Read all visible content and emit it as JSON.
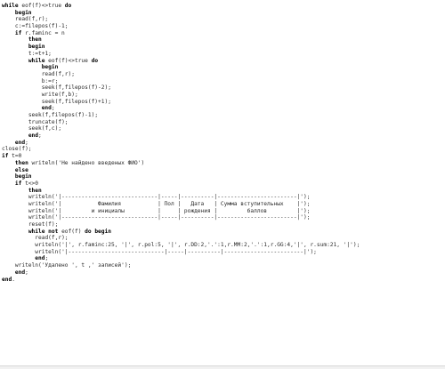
{
  "editor": {
    "lines": [
      {
        "pre": "",
        "kw": "while",
        "rest": " eof(f)<>true ",
        "kw2": "do",
        "rest2": ""
      },
      {
        "pre": "    ",
        "kw": "begin",
        "rest": ""
      },
      {
        "pre": "    ",
        "kw": "",
        "rest": "read(f,r);"
      },
      {
        "pre": "    ",
        "kw": "",
        "rest": "c:=filepos(f)-1;"
      },
      {
        "pre": "    ",
        "kw": "if",
        "rest": " r.faminc = n"
      },
      {
        "pre": "        ",
        "kw": "then",
        "rest": ""
      },
      {
        "pre": "        ",
        "kw": "begin",
        "rest": ""
      },
      {
        "pre": "        ",
        "kw": "",
        "rest": "t:=t+1;"
      },
      {
        "pre": "        ",
        "kw": "while",
        "rest": " eof(f)<>true ",
        "kw2": "do",
        "rest2": ""
      },
      {
        "pre": "            ",
        "kw": "begin",
        "rest": ""
      },
      {
        "pre": "            ",
        "kw": "",
        "rest": "read(f,r);"
      },
      {
        "pre": "            ",
        "kw": "",
        "rest": "b:=r;"
      },
      {
        "pre": "            ",
        "kw": "",
        "rest": "seek(f,filepos(f)-2);"
      },
      {
        "pre": "            ",
        "kw": "",
        "rest": "write(f,b);"
      },
      {
        "pre": "            ",
        "kw": "",
        "rest": "seek(f,filepos(f)+1);"
      },
      {
        "pre": "            ",
        "kw": "end",
        "rest": ";"
      },
      {
        "pre": "        ",
        "kw": "",
        "rest": "seek(f,filepos(f)-1);"
      },
      {
        "pre": "        ",
        "kw": "",
        "rest": "truncate(f);"
      },
      {
        "pre": "        ",
        "kw": "",
        "rest": "seek(f,c);"
      },
      {
        "pre": "        ",
        "kw": "end",
        "rest": ";"
      },
      {
        "pre": "    ",
        "kw": "end",
        "rest": ";"
      },
      {
        "pre": "",
        "kw": "",
        "rest": "close(f);"
      },
      {
        "pre": "",
        "kw": "if",
        "rest": " t=0"
      },
      {
        "pre": "    ",
        "kw": "then",
        "rest": " writeln('Не найдено введеных ФИО')"
      },
      {
        "pre": "    ",
        "kw": "else",
        "rest": ""
      },
      {
        "pre": "    ",
        "kw": "begin",
        "rest": ""
      },
      {
        "pre": "    ",
        "kw": "if",
        "rest": " t<>0"
      },
      {
        "pre": "        ",
        "kw": "then",
        "rest": ""
      },
      {
        "pre": "        ",
        "kw": "",
        "rest": "writeln('|-----------------------------|-----|----------|------------------------|');"
      },
      {
        "pre": "        ",
        "kw": "",
        "rest": "writeln('|           Фамилия           | Пол |   Дата   | Сумма вступительных    |');"
      },
      {
        "pre": "        ",
        "kw": "",
        "rest": "writeln('|         и инициалы          |     | рождения |         баллов         |');"
      },
      {
        "pre": "        ",
        "kw": "",
        "rest": "writeln('|-----------------------------|-----|----------|------------------------|');"
      },
      {
        "pre": "        ",
        "kw": "",
        "rest": "reset(f);"
      },
      {
        "pre": "        ",
        "kw": "while not",
        "rest": " eof(f) ",
        "kw2": "do begin",
        "rest2": ""
      },
      {
        "pre": "          ",
        "kw": "",
        "rest": "read(f,r);"
      },
      {
        "pre": "          ",
        "kw": "",
        "rest": "writeln('|', r.faminc:25, '|', r.pol:5, '|', r.DD:2,'.':1,r.MM:2,'.':1,r.GG:4,'|', r.sum:21, '|');"
      },
      {
        "pre": "          ",
        "kw": "",
        "rest": "writeln('|-----------------------------|-----|----------|------------------------|');"
      },
      {
        "pre": "          ",
        "kw": "end",
        "rest": ";"
      },
      {
        "pre": "    ",
        "kw": "",
        "rest": "writeln('Удалено ', t ,' записей');"
      },
      {
        "pre": "    ",
        "kw": "end",
        "rest": ";"
      },
      {
        "pre": "",
        "kw": "end",
        "rest": "."
      }
    ]
  }
}
